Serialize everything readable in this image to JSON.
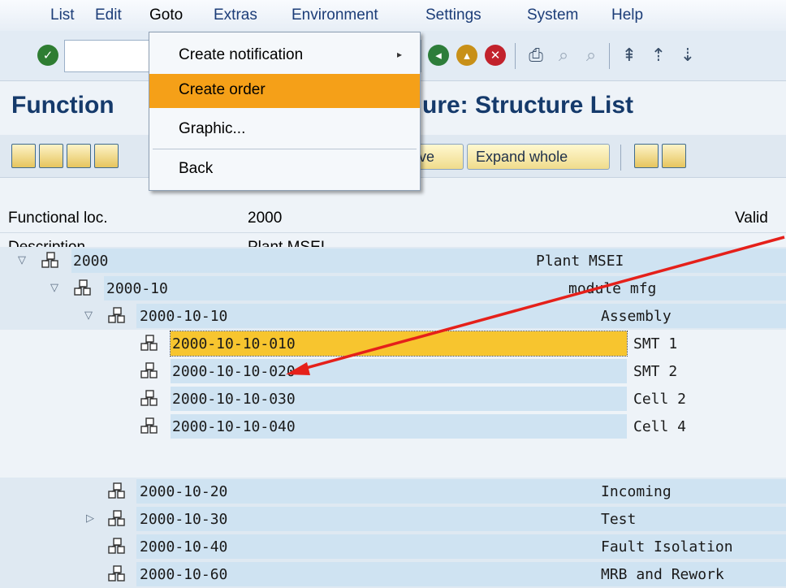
{
  "menubar": {
    "items": [
      "List",
      "Edit",
      "Goto",
      "Extras",
      "Environment",
      "Settings",
      "System",
      "Help"
    ]
  },
  "toolbar": {
    "icons": [
      "check-icon",
      "back-icon",
      "exit-icon",
      "cancel-icon",
      "print-icon",
      "find-icon",
      "find-next-icon",
      "first-page-icon",
      "previous-page-icon",
      "next-page-icon"
    ]
  },
  "title": {
    "visible_text": "Function",
    "visible_text_2": "ure: Structure List"
  },
  "app_toolbar": {
    "partial_button_label": "ve",
    "expand_whole_label": "Expand whole"
  },
  "header": {
    "functional_loc_label": "Functional loc.",
    "functional_loc_value": "2000",
    "valid_label": "Valid",
    "description_label": "Description",
    "description_value": "Plant MSEI"
  },
  "goto_menu": {
    "items": [
      {
        "label": "Create notification",
        "has_submenu": true
      },
      {
        "label": "Create order",
        "highlighted": true
      },
      {
        "label": "Graphic..."
      },
      {
        "label": "Back"
      }
    ]
  },
  "tree": {
    "rows": [
      {
        "id": "2000",
        "desc": "Plant MSEI",
        "expanded": true
      },
      {
        "id": "2000-10",
        "desc": "module mfg",
        "expanded": true
      },
      {
        "id": "2000-10-10",
        "desc": "Assembly",
        "expanded": true
      },
      {
        "id": "2000-10-10-010",
        "desc": "SMT 1",
        "selected": true
      },
      {
        "id": "2000-10-10-020",
        "desc": "SMT 2"
      },
      {
        "id": "2000-10-10-030",
        "desc": "Cell 2"
      },
      {
        "id": "2000-10-10-040",
        "desc": "Cell 4"
      },
      {
        "id": "2000-10-20",
        "desc": "Incoming"
      },
      {
        "id": "2000-10-30",
        "desc": "Test",
        "collapsed": true
      },
      {
        "id": "2000-10-40",
        "desc": "Fault Isolation"
      },
      {
        "id": "2000-10-60",
        "desc": "MRB and Rework"
      }
    ]
  },
  "colors": {
    "accent_orange": "#f5a018",
    "selection_yellow": "#f7c52f",
    "annotation_arrow": "#e5201a",
    "title_blue": "#153a6b"
  }
}
